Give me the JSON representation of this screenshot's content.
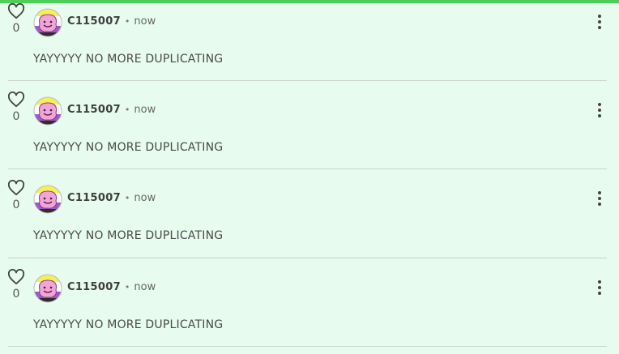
{
  "comments": [
    {
      "likes": "0",
      "username": "C115007",
      "separator": "•",
      "time": "now",
      "text": "YAYYYYY NO MORE DUPLICATING"
    },
    {
      "likes": "0",
      "username": "C115007",
      "separator": "•",
      "time": "now",
      "text": "YAYYYYY NO MORE DUPLICATING"
    },
    {
      "likes": "0",
      "username": "C115007",
      "separator": "•",
      "time": "now",
      "text": "YAYYYYY NO MORE DUPLICATING"
    },
    {
      "likes": "0",
      "username": "C115007",
      "separator": "•",
      "time": "now",
      "text": "YAYYYYY NO MORE DUPLICATING"
    }
  ],
  "icons": {
    "like": "heart-icon",
    "menu": "more-vertical-icon",
    "avatar": "avatar-image"
  },
  "colors": {
    "accent_bar": "#4dcf5a",
    "background": "#e8fbef",
    "avatar_flag_top": "#f5ef5a",
    "avatar_flag_bottom": "#9b59c9",
    "avatar_face": "#f4a3d9"
  }
}
